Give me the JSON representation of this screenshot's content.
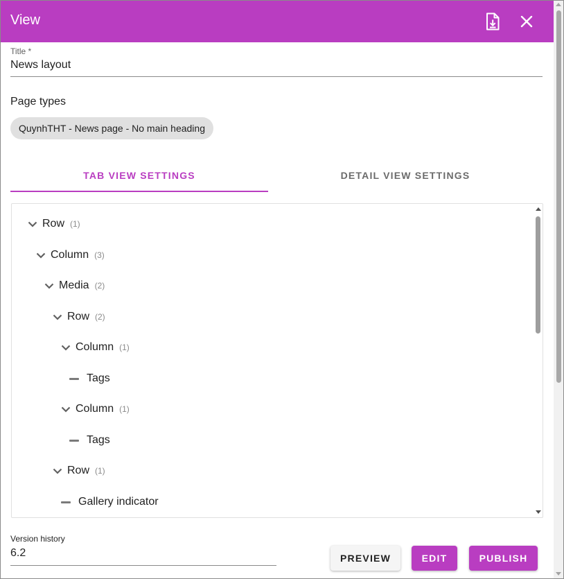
{
  "header": {
    "title": "View",
    "download_icon": "file-download-icon",
    "close_icon": "close-icon",
    "color": "#b93dc1"
  },
  "title_field": {
    "label": "Title *",
    "value": "News layout"
  },
  "page_types": {
    "label": "Page types",
    "chips": [
      "QuynhTHT - News page - No main heading"
    ]
  },
  "tabs": [
    {
      "label": "TAB VIEW SETTINGS",
      "active": true
    },
    {
      "label": "DETAIL VIEW SETTINGS",
      "active": false
    }
  ],
  "tree": {
    "nodes": [
      {
        "label": "Row",
        "count": "(1)",
        "expandable": true,
        "depth": 0
      },
      {
        "label": "Column",
        "count": "(3)",
        "expandable": true,
        "depth": 1
      },
      {
        "label": "Media",
        "count": "(2)",
        "expandable": true,
        "depth": 2
      },
      {
        "label": "Row",
        "count": "(2)",
        "expandable": true,
        "depth": 3
      },
      {
        "label": "Column",
        "count": "(1)",
        "expandable": true,
        "depth": 4
      },
      {
        "label": "Tags",
        "count": "",
        "expandable": false,
        "depth": 5
      },
      {
        "label": "Column",
        "count": "(1)",
        "expandable": true,
        "depth": 4
      },
      {
        "label": "Tags",
        "count": "",
        "expandable": false,
        "depth": 5
      },
      {
        "label": "Row",
        "count": "(1)",
        "expandable": true,
        "depth": 3
      },
      {
        "label": "Gallery indicator",
        "count": "",
        "expandable": false,
        "depth": 4
      }
    ]
  },
  "version_history": {
    "label": "Version history",
    "value": "6.2"
  },
  "actions": {
    "preview_label": "PREVIEW",
    "edit_label": "EDIT",
    "publish_label": "PUBLISH"
  }
}
